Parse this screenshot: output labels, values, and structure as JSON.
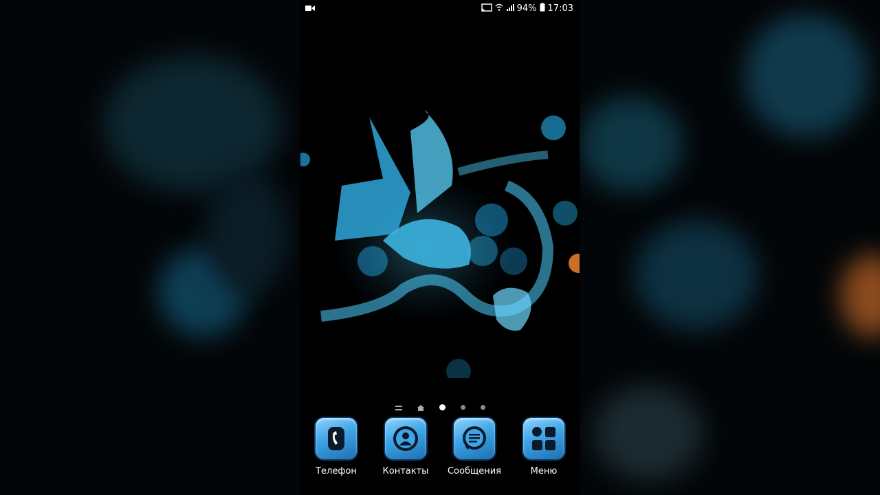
{
  "status_bar": {
    "battery_percent": "94%",
    "time": "17:03"
  },
  "page_indicator": {
    "pages": 5,
    "active_index": 2
  },
  "dock": {
    "apps": [
      {
        "label": "Телефон",
        "icon": "phone-icon"
      },
      {
        "label": "Контакты",
        "icon": "contacts-icon"
      },
      {
        "label": "Сообщения",
        "icon": "messages-icon"
      },
      {
        "label": "Меню",
        "icon": "apps-grid-icon"
      }
    ]
  },
  "colors": {
    "accent": "#3ea4e6",
    "icon_border": "#0b3a63",
    "wallpaper_glow": "#37c8ff"
  }
}
